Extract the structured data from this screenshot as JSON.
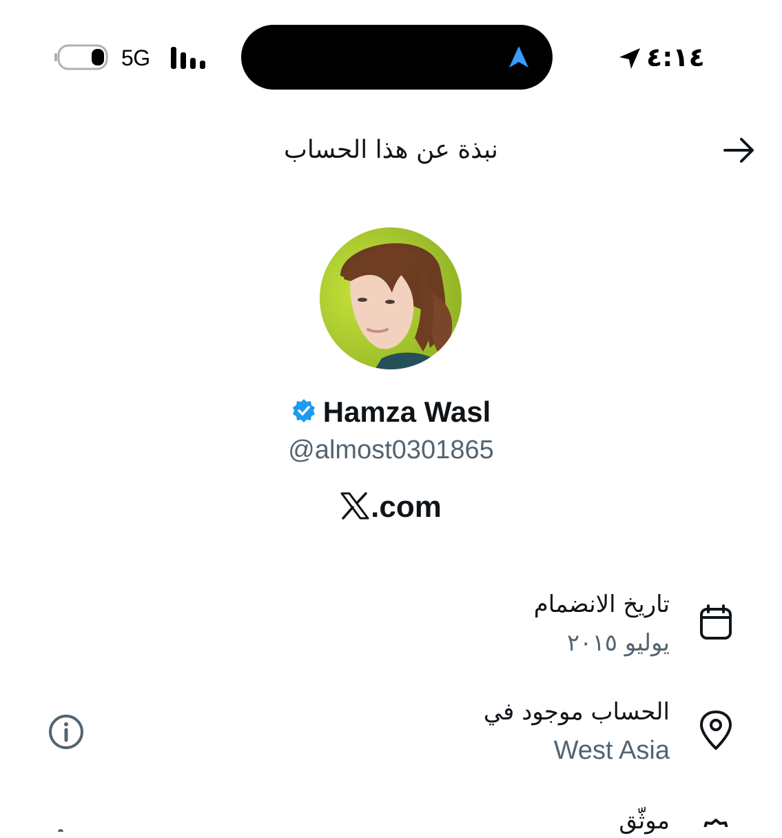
{
  "status_bar": {
    "network": "5G",
    "time": "٤:١٤",
    "icons": [
      "battery-icon",
      "signal-bars-icon",
      "navigation-arrow-icon",
      "location-arrow-icon"
    ]
  },
  "header": {
    "title": "نبذة عن هذا الحساب",
    "back_icon": "arrow-right-icon"
  },
  "profile": {
    "display_name": "Hamza Wasl",
    "handle": "@almost0301865",
    "verified": true,
    "brand_suffix": ".com"
  },
  "details": {
    "joined": {
      "title": "تاريخ الانضمام",
      "value": "يوليو ٢٠١٥",
      "icon": "calendar-icon"
    },
    "location": {
      "title": "الحساب موجود في",
      "value": "West Asia",
      "icon": "location-pin-icon"
    },
    "verified": {
      "title": "موثّق",
      "icon": "verified-badge-icon"
    }
  },
  "colors": {
    "text_primary": "#0f1419",
    "text_secondary": "#536471",
    "verified_blue": "#1d9bf0",
    "island": "#000000"
  }
}
